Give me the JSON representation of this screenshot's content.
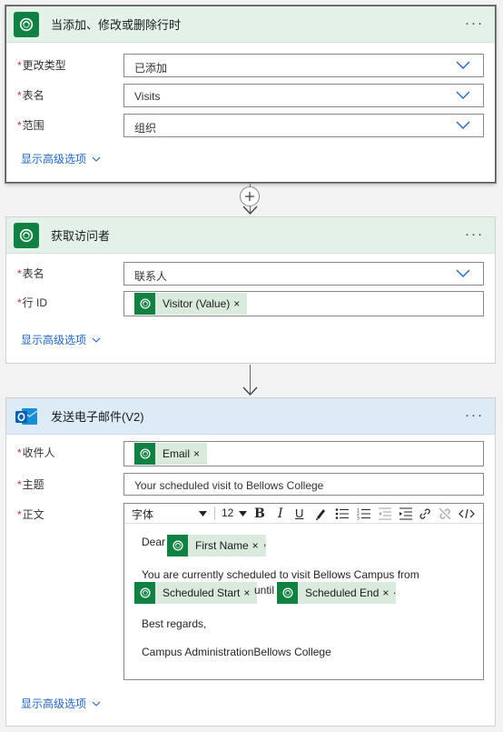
{
  "cards": [
    {
      "title": "当添加、修改或删除行时",
      "menu": "···",
      "fields": [
        {
          "label": "更改类型",
          "value": "已添加"
        },
        {
          "label": "表名",
          "value": "Visits"
        },
        {
          "label": "范围",
          "value": "组织"
        }
      ],
      "advanced": "显示高级选项"
    },
    {
      "title": "获取访问者",
      "menu": "···",
      "fields": [
        {
          "label": "表名",
          "value": "联系人"
        },
        {
          "label": "行 ID",
          "token": "Visitor (Value)"
        }
      ],
      "advanced": "显示高级选项"
    },
    {
      "title": "发送电子邮件(V2)",
      "menu": "···",
      "fields": [
        {
          "label": "收件人",
          "token": "Email"
        },
        {
          "label": "主题",
          "value": "Your scheduled visit to Bellows College"
        },
        {
          "label": "正文"
        }
      ],
      "editor": {
        "font": "字体",
        "size": "12",
        "line1_prefix": "Dear",
        "token_first_name": "First Name",
        "comma": ",",
        "line2": "You are currently scheduled to visit Bellows Campus from",
        "token_start": "Scheduled Start",
        "until": "until",
        "token_end": "Scheduled End",
        "period": ".",
        "line3": "Best regards,",
        "line4": "Campus AdministrationBellows College"
      },
      "advanced": "显示高级选项"
    }
  ],
  "token_remove": "×",
  "required_mark": "*",
  "colors": {
    "dataverse_green": "#108142",
    "token_bg": "#daeadd",
    "link_blue": "#2266c2",
    "header_green": "#e3f1e8",
    "header_blue": "#ddebf7",
    "required_red": "#c4314b"
  }
}
